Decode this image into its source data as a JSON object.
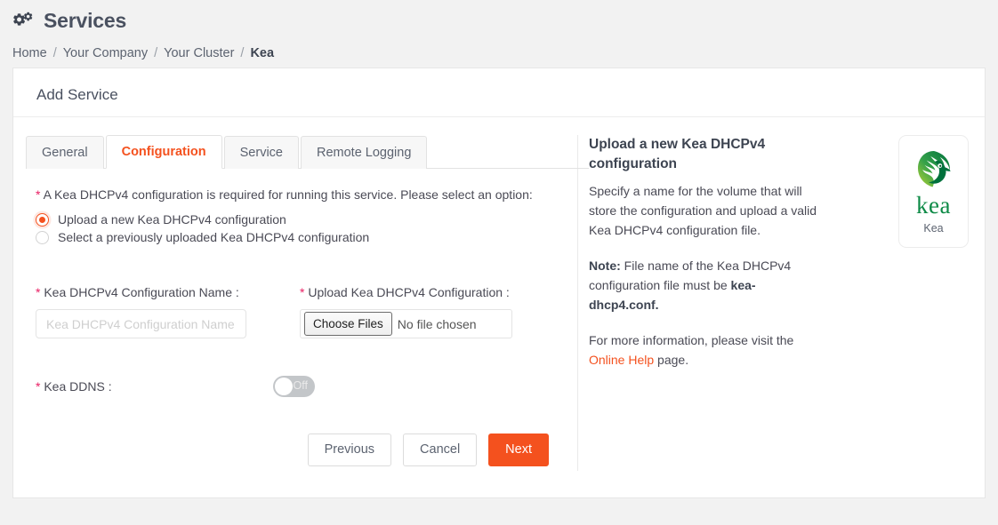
{
  "header": {
    "title": "Services",
    "icon": "cogs-icon"
  },
  "breadcrumb": {
    "items": [
      {
        "label": "Home",
        "active": false
      },
      {
        "label": "Your Company",
        "active": false
      },
      {
        "label": "Your Cluster",
        "active": false
      },
      {
        "label": "Kea",
        "active": true
      }
    ],
    "separator": "/"
  },
  "card": {
    "title": "Add Service"
  },
  "tabs": [
    {
      "label": "General",
      "active": false
    },
    {
      "label": "Configuration",
      "active": true
    },
    {
      "label": "Service",
      "active": false
    },
    {
      "label": "Remote Logging",
      "active": false
    }
  ],
  "form": {
    "requirement_note": "A Kea DHCPv4 configuration is required for running this service. Please select an option:",
    "asterisk": "*",
    "radio_options": [
      {
        "label": "Upload a new Kea DHCPv4 configuration",
        "selected": true
      },
      {
        "label": "Select a previously uploaded Kea DHCPv4 configuration",
        "selected": false
      }
    ],
    "config_name": {
      "label": "Kea DHCPv4 Configuration Name :",
      "value": "",
      "placeholder": "Kea DHCPv4 Configuration Name"
    },
    "upload": {
      "label": "Upload Kea DHCPv4 Configuration :",
      "button_label": "Choose Files",
      "status": "No file chosen"
    },
    "ddns": {
      "label": "Kea DDNS :",
      "state": "Off"
    },
    "buttons": {
      "previous": "Previous",
      "cancel": "Cancel",
      "next": "Next"
    }
  },
  "info_panel": {
    "heading": "Upload a new Kea DHCPv4 configuration",
    "description": "Specify a name for the volume that will store the configuration and upload a valid Kea DHCPv4 configuration file.",
    "note_label": "Note:",
    "note_text": " File name of the Kea DHCPv4 configuration file must be ",
    "note_filename": "kea-dhcp4.conf.",
    "more_info_prefix": "For more information, please visit the ",
    "more_info_link": "Online Help",
    "more_info_suffix": " page.",
    "logo": {
      "wordmark": "kea",
      "caption": "Kea"
    }
  },
  "colors": {
    "accent": "#f4511e",
    "required": "#e91e63",
    "text": "#4a4a55",
    "page_bg": "#f2f2f2",
    "kea_green": "#0d8a46"
  }
}
